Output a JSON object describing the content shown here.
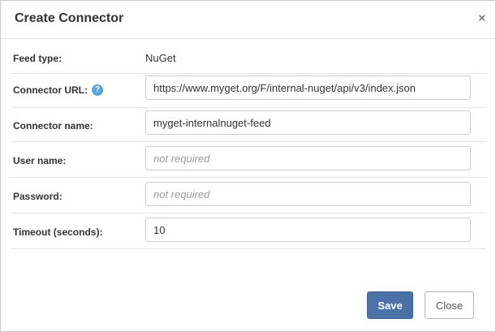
{
  "dialog": {
    "title": "Create Connector",
    "close_glyph": "×"
  },
  "form": {
    "feed_type": {
      "label": "Feed type:",
      "value": "NuGet"
    },
    "connector_url": {
      "label": "Connector URL:",
      "value": "https://www.myget.org/F/internal-nuget/api/v3/index.json",
      "help_icon": "question-circle-icon",
      "help_glyph": "?"
    },
    "connector_name": {
      "label": "Connector name:",
      "value": "myget-internalnuget-feed"
    },
    "user_name": {
      "label": "User name:",
      "value": "",
      "placeholder": "not required"
    },
    "password": {
      "label": "Password:",
      "value": "",
      "placeholder": "not required"
    },
    "timeout": {
      "label": "Timeout (seconds):",
      "value": "10"
    }
  },
  "footer": {
    "save_label": "Save",
    "close_label": "Close"
  },
  "colors": {
    "primary_button": "#4a72a6",
    "help_icon": "#5aa3dc"
  }
}
